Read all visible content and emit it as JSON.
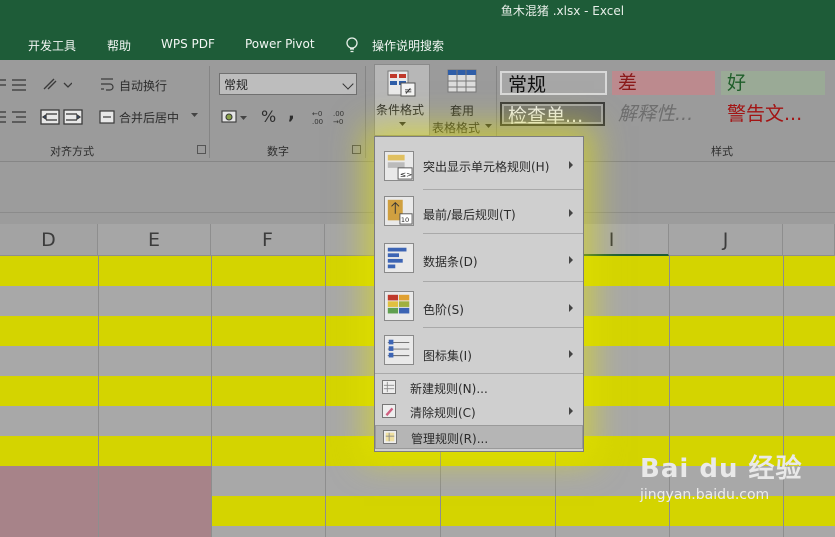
{
  "window": {
    "title": "鱼木混猪 .xlsx  -  Excel"
  },
  "tabs": [
    "开发工具",
    "帮助",
    "WPS PDF",
    "Power Pivot",
    "操作说明搜索"
  ],
  "ribbon": {
    "wrap_text": "自动换行",
    "merge_center": "合并后居中",
    "alignment_group": "对齐方式",
    "number_format": "常规",
    "percent": "%",
    "comma": ",",
    "number_group": "数字",
    "conditional_format_line1": "条件格式",
    "table_format_line1": "套用",
    "table_format_line2": "表格格式",
    "styles_group": "样式",
    "styles": {
      "normal": "常规",
      "bad": "差",
      "good": "好",
      "check_cell": "检查单...",
      "explanatory": "解释性...",
      "warning": "警告文..."
    }
  },
  "columns": [
    "D",
    "E",
    "F",
    "I",
    "J"
  ],
  "menu": {
    "items": [
      {
        "label": "突出显示单元格规则(H)",
        "icon": "highlight-cells-icon",
        "submenu": true
      },
      {
        "label": "最前/最后规则(T)",
        "icon": "top-bottom-rules-icon",
        "submenu": true
      },
      {
        "label": "数据条(D)",
        "icon": "data-bars-icon",
        "submenu": true
      },
      {
        "label": "色阶(S)",
        "icon": "color-scales-icon",
        "submenu": true
      },
      {
        "label": "图标集(I)",
        "icon": "icon-sets-icon",
        "submenu": true
      },
      {
        "label": "新建规则(N)...",
        "icon": "new-rule-icon",
        "submenu": false
      },
      {
        "label": "清除规则(C)",
        "icon": "clear-rules-icon",
        "submenu": true
      },
      {
        "label": "管理规则(R)...",
        "icon": "manage-rules-icon",
        "submenu": false
      }
    ]
  },
  "watermark": {
    "brand": "Bai du 经验",
    "url": "jingyan.baidu.com"
  },
  "colors": {
    "excel_green": "#1e5c38",
    "highlight_yellow": "#e0e000",
    "band_gray": "#a8a8a8",
    "pink_cell": "#a78389"
  }
}
